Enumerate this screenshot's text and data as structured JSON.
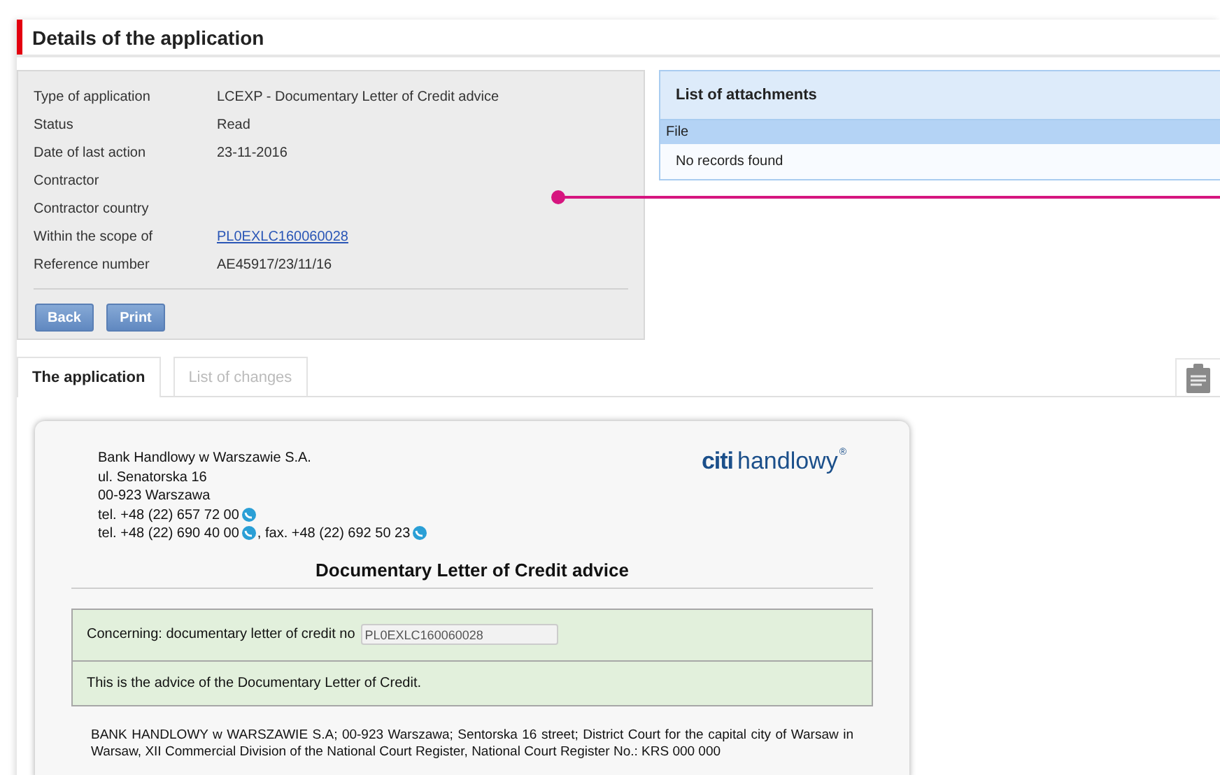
{
  "page_title": "Details of the application",
  "details": {
    "rows": [
      {
        "label": "Type of application",
        "value": "LCEXP - Documentary Letter of Credit advice",
        "kind": "text"
      },
      {
        "label": "Status",
        "value": "Read",
        "kind": "text"
      },
      {
        "label": "Date of last action",
        "value": "23-11-2016",
        "kind": "text"
      },
      {
        "label": "Contractor",
        "kind": "text"
      },
      {
        "label": "Contractor country",
        "kind": "text"
      },
      {
        "label": "Within the scope of",
        "value": "PL0EXLC160060028",
        "kind": "link"
      },
      {
        "label": "Reference number",
        "value": "AE45917/23/11/16",
        "kind": "text"
      }
    ],
    "buttons": [
      "Back",
      "Print"
    ]
  },
  "attachments": {
    "title": "List of attachments",
    "columns": [
      "File"
    ],
    "empty_text": "No records found"
  },
  "tabs": [
    {
      "label": "The application",
      "selected": true
    },
    {
      "label": "List of changes",
      "selected": false
    }
  ],
  "document": {
    "address_lines": [
      [
        {
          "text": "Bank Handlowy w Warszawie S.A.",
          "call_icon": false
        }
      ],
      [
        {
          "text": "ul. Senatorska 16",
          "call_icon": false
        }
      ],
      [
        {
          "text": "00-923 Warszawa",
          "call_icon": false
        }
      ],
      [
        {
          "text": "tel. +48 (22) 657 72 00",
          "call_icon": true
        }
      ],
      [
        {
          "text": "tel. +48 (22) 690 40 00",
          "call_icon": true
        },
        {
          "text": ", fax. +48 (22) 692 50 23",
          "call_icon": true
        }
      ]
    ],
    "logo": {
      "brand": "citi",
      "name": "handlowy",
      "mark": "®"
    },
    "title": "Documentary Letter of Credit advice",
    "concerning": {
      "label": "Concerning: documentary letter of credit no",
      "value": "PL0EXLC160060028"
    },
    "notice": "This is the advice of the Documentary Letter of Credit.",
    "footer": "BANK HANDLOWY w WARSZAWIE S.A; 00-923 Warszawa; Sentorska 16 street; District Court for the capital city of Warsaw in Warsaw, XII Commercial Division of the National Court Register, National Court Register No.: KRS 000 000"
  }
}
